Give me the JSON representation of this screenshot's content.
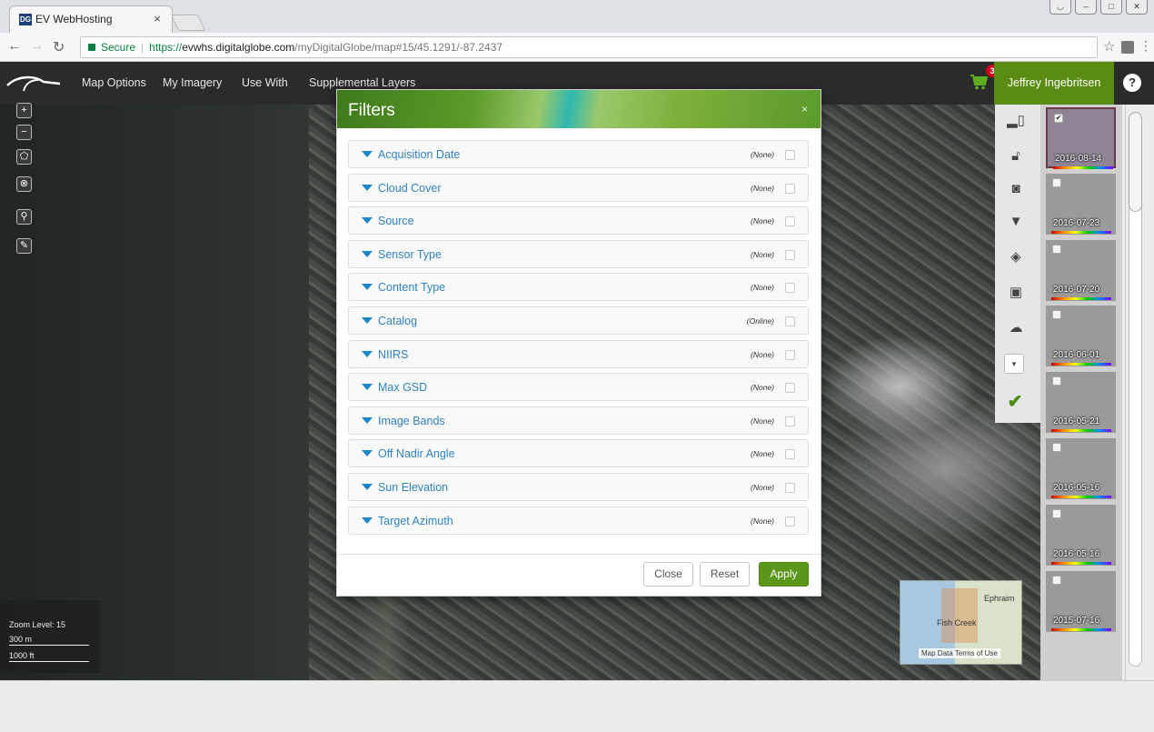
{
  "browser": {
    "tab_title": "EV WebHosting",
    "tab_favicon": "DG",
    "tab_close": "×",
    "secure_label": "Secure",
    "url_scheme": "https://",
    "url_host": "evwhs.digitalglobe.com",
    "url_path": "/myDigitalGlobe/map#15/45.1291/-87.2437"
  },
  "header": {
    "menu": [
      "Map Options",
      "My Imagery",
      "Use With",
      "Supplemental Layers"
    ],
    "cart_count": "3",
    "user_name": "Jeffrey Ingebritsen",
    "help_glyph": "?"
  },
  "map": {
    "zoom_label": "Zoom Level: 15",
    "scale_metric": "300 m",
    "scale_imperial": "1000 ft",
    "minimap": {
      "places": [
        "Ephraim",
        "Fish Creek"
      ],
      "footer": "Map Data  Terms of Use"
    }
  },
  "filters_dialog": {
    "title": "Filters",
    "rows": [
      {
        "label": "Acquisition Date",
        "value": "(None)"
      },
      {
        "label": "Cloud Cover",
        "value": "(None)"
      },
      {
        "label": "Source",
        "value": "(None)"
      },
      {
        "label": "Sensor Type",
        "value": "(None)"
      },
      {
        "label": "Content Type",
        "value": "(None)"
      },
      {
        "label": "Catalog",
        "value": "(Online)"
      },
      {
        "label": "NIIRS",
        "value": "(None)"
      },
      {
        "label": "Max GSD",
        "value": "(None)"
      },
      {
        "label": "Image Bands",
        "value": "(None)"
      },
      {
        "label": "Off Nadir Angle",
        "value": "(None)"
      },
      {
        "label": "Sun Elevation",
        "value": "(None)"
      },
      {
        "label": "Target Azimuth",
        "value": "(None)"
      }
    ],
    "buttons": {
      "close": "Close",
      "reset": "Reset",
      "apply": "Apply"
    }
  },
  "tools": [
    "layout-icon",
    "unlock-icon",
    "camera-icon",
    "filter-icon",
    "layers-icon",
    "compare-icon",
    "cloud-download-icon",
    "dropdown-icon",
    "checkmark-icon"
  ],
  "thumbnails": [
    {
      "date": "2016-08-14",
      "checked": true
    },
    {
      "date": "2016-07-23",
      "checked": false
    },
    {
      "date": "2016-07-20",
      "checked": false
    },
    {
      "date": "2016-06-01",
      "checked": false
    },
    {
      "date": "2016-05-21",
      "checked": false
    },
    {
      "date": "2016-05-16",
      "checked": false
    },
    {
      "date": "2016-05-16",
      "checked": false
    },
    {
      "date": "2015-07-16",
      "checked": false
    }
  ],
  "colors": {
    "brand_green": "#5a9619",
    "header_bg": "#2b2b2b",
    "link_blue": "#2f83c2"
  }
}
